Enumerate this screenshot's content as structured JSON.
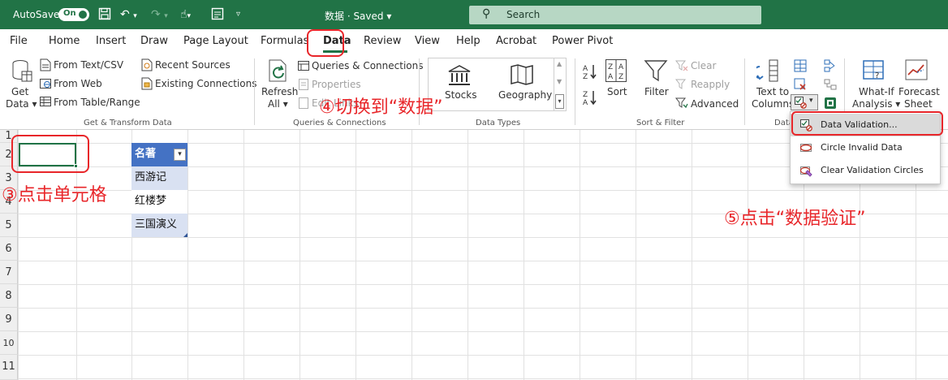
{
  "titlebar": {
    "autosave_label": "AutoSave",
    "autosave_toggle": "On",
    "doc_title": "数据 · Saved ▾",
    "search_placeholder": "Search"
  },
  "tabs": [
    "File",
    "Home",
    "Insert",
    "Draw",
    "Page Layout",
    "Formulas",
    "Data",
    "Review",
    "View",
    "Help",
    "Acrobat",
    "Power Pivot"
  ],
  "active_tab": "Data",
  "ribbon": {
    "get_transform": {
      "get_data_line1": "Get",
      "get_data_line2": "Data ▾",
      "from_text": "From Text/CSV",
      "from_web": "From Web",
      "from_table": "From Table/Range",
      "recent_sources": "Recent Sources",
      "existing_connections": "Existing Connections",
      "group_label": "Get & Transform Data"
    },
    "queries": {
      "refresh_line1": "Refresh",
      "refresh_line2": "All ▾",
      "queries_connections": "Queries & Connections",
      "properties": "Properties",
      "edit_links": "Edit Links",
      "group_label": "Queries & Connections"
    },
    "data_types": {
      "stocks": "Stocks",
      "geography": "Geography",
      "group_label": "Data Types"
    },
    "sort_filter": {
      "sort": "Sort",
      "filter": "Filter",
      "clear": "Clear",
      "reapply": "Reapply",
      "advanced": "Advanced",
      "group_label": "Sort & Filter"
    },
    "data_tools": {
      "text_to_columns_line1": "Text to",
      "text_to_columns_line2": "Columns",
      "group_label": "Data"
    },
    "forecast": {
      "whatif_line1": "What-If",
      "whatif_line2": "Analysis ▾",
      "forecast_line1": "Forecast",
      "forecast_line2": "Sheet"
    }
  },
  "dropdown_menu": {
    "items": [
      "Data Validation...",
      "Circle Invalid Data",
      "Clear Validation Circles"
    ],
    "highlighted_index": 0
  },
  "sheet": {
    "row_numbers": [
      "1",
      "2",
      "3",
      "4",
      "5",
      "6",
      "7",
      "8",
      "9",
      "10",
      "11"
    ],
    "header": "名著",
    "values": [
      "西游记",
      "红楼梦",
      "三国演义"
    ]
  },
  "annotations": {
    "step3": "③点击单元格",
    "step4": "④切换到“数据”",
    "step5": "⑤点击“数据验证”"
  },
  "colors": {
    "excel_green": "#217346",
    "annotation_red": "#e8262a",
    "table_header_blue": "#4472c4",
    "table_band_blue": "#d9e1f2"
  }
}
